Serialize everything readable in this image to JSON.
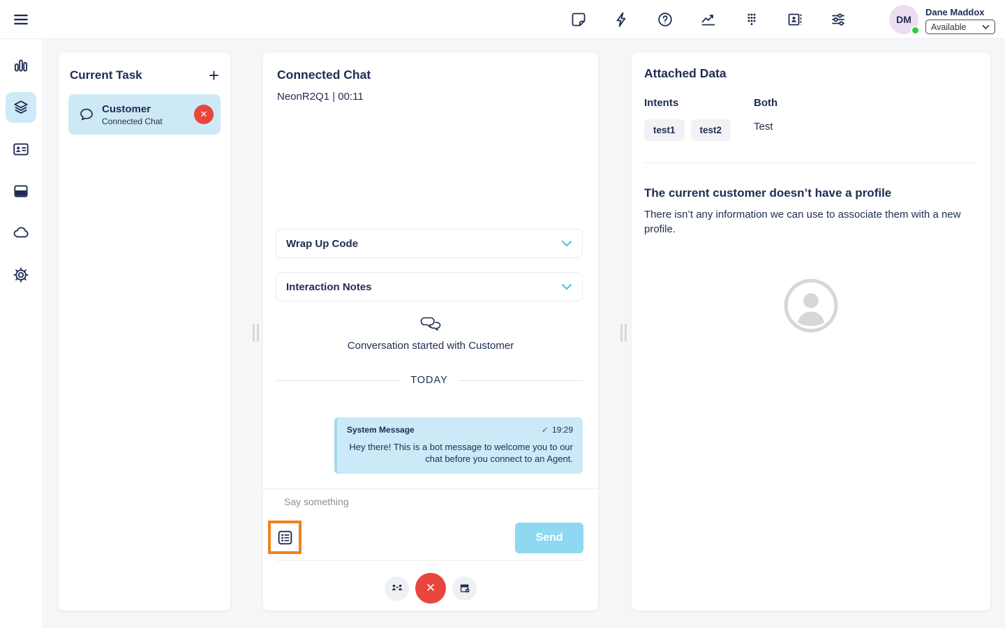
{
  "colors": {
    "navy": "#1e2c52",
    "accent_blue": "#59bfe8",
    "light_blue_fill": "#cde9f6",
    "bubble_border": "#a6d8ec",
    "send_blue": "#8ed8f2",
    "red": "#e8463d",
    "orange": "#f0821e",
    "green": "#2ecc40",
    "avatar_pink": "#eeddf2",
    "page_bg": "#f5f6f7"
  },
  "topbar": {
    "icons": [
      "note-icon",
      "lightning-icon",
      "help-icon",
      "performance-icon",
      "dialpad-icon",
      "contacts-icon",
      "preferences-icon"
    ],
    "user": {
      "initials": "DM",
      "name": "Dane Maddox",
      "status": "Available"
    }
  },
  "sidebar": {
    "icons": [
      "menu-icon",
      "activity-icon",
      "interactions-icon",
      "directory-icon",
      "apps-icon",
      "cloud-icon",
      "settings-icon"
    ],
    "active": "interactions-icon"
  },
  "current_task": {
    "title": "Current Task",
    "add_glyph": "+",
    "task": {
      "name": "Customer",
      "type": "Connected Chat",
      "close_glyph": "✕"
    }
  },
  "chat": {
    "title": "Connected Chat",
    "subtitle": "NeonR2Q1 | 00:11",
    "wrap_up_label": "Wrap Up Code",
    "notes_label": "Interaction Notes",
    "started_text": "Conversation started with Customer",
    "day_divider": "TODAY",
    "message": {
      "sender": "System Message",
      "delivered_glyph": "✓",
      "time": "19:29",
      "text": "Hey there! This is a bot message to welcome you to our chat before you connect to an Agent."
    },
    "input_placeholder": "Say something",
    "send_label": "Send",
    "actions": {
      "close_glyph": "✕"
    }
  },
  "attached_data": {
    "title": "Attached Data",
    "intents_label": "Intents",
    "intents": [
      "test1",
      "test2"
    ],
    "both_label": "Both",
    "both_value": "Test",
    "no_profile_title": "The current customer doesn’t have a profile",
    "no_profile_text": "There isn’t any information we can use to associate them with a new profile."
  }
}
